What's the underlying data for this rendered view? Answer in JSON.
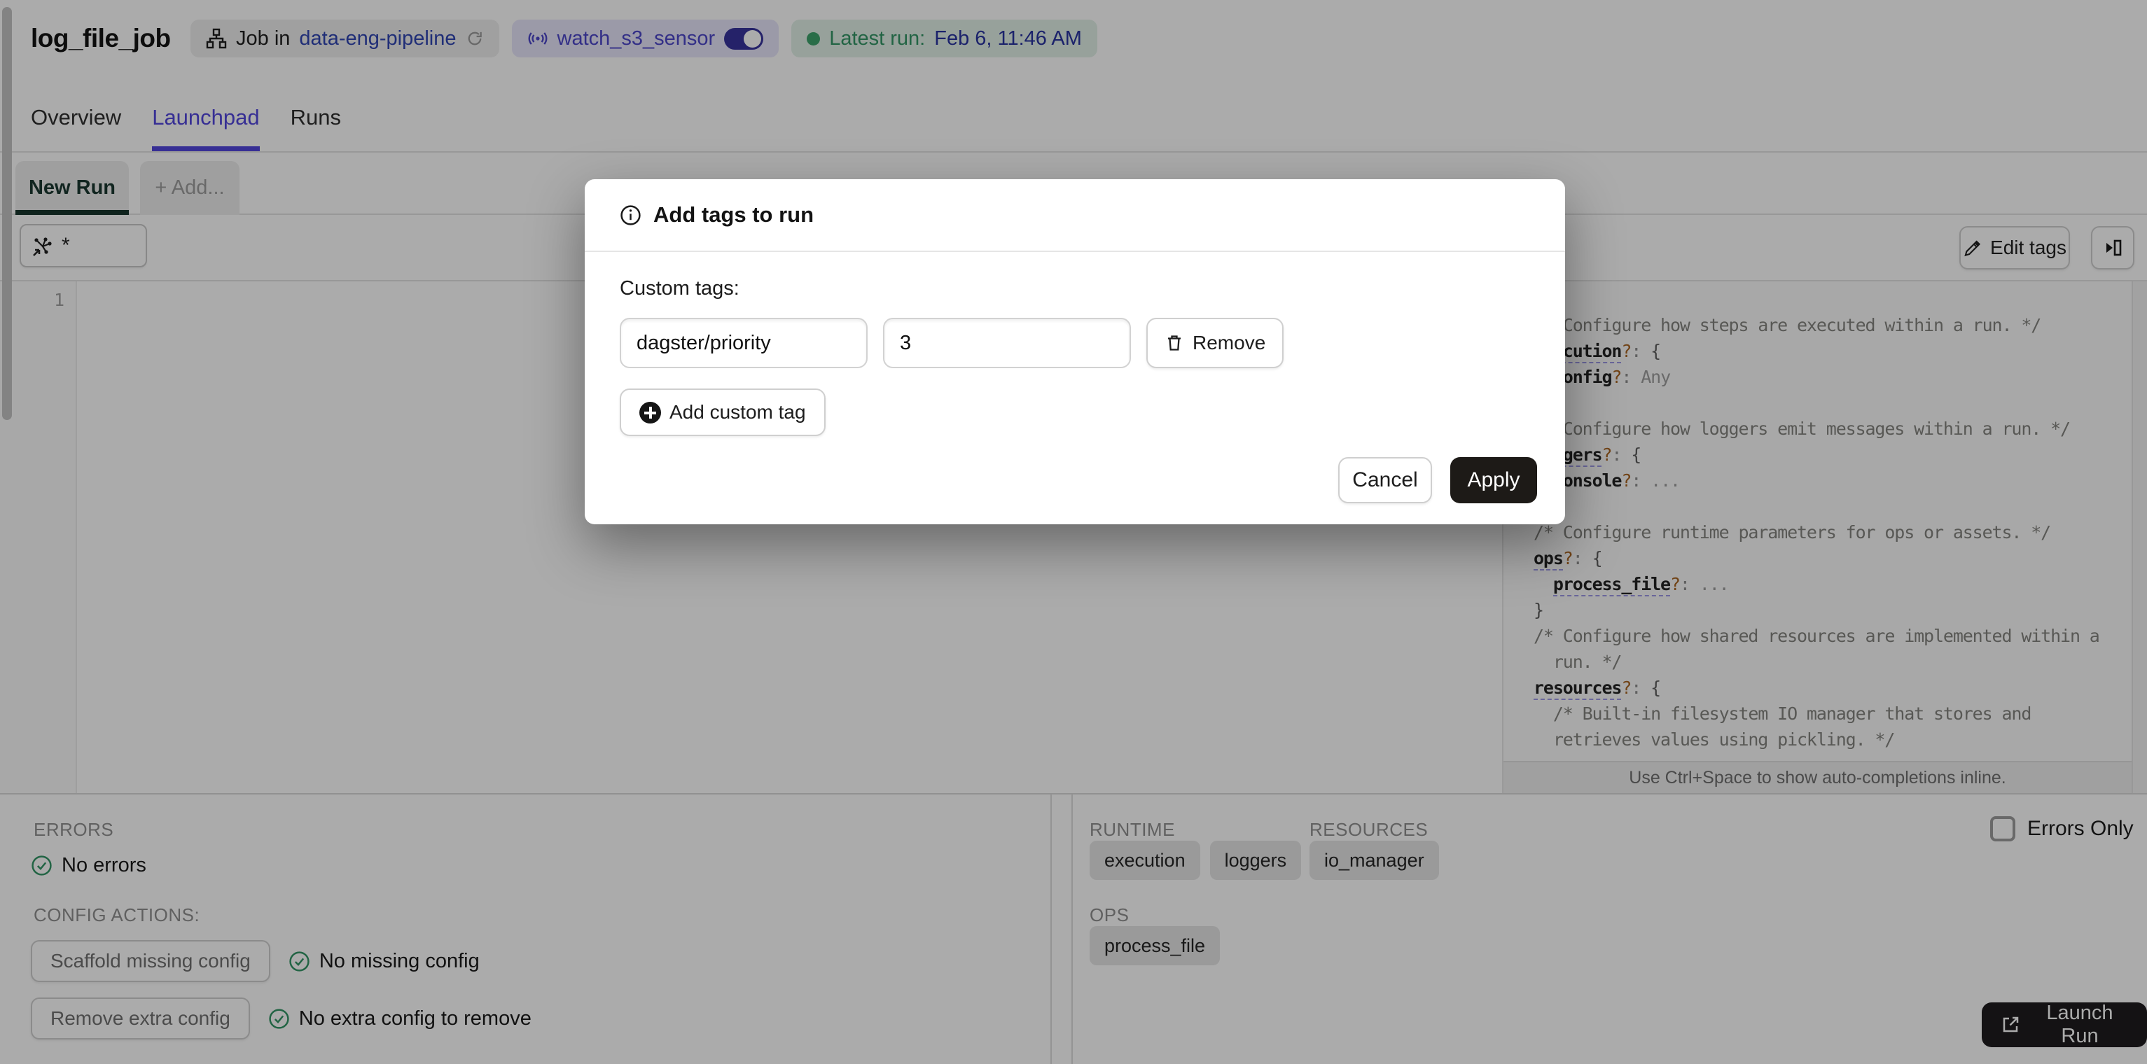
{
  "header": {
    "title": "log_file_job",
    "job_badge": {
      "prefix": "Job in",
      "link": "data-eng-pipeline"
    },
    "sensor_badge": {
      "label": "watch_s3_sensor"
    },
    "latest_run": {
      "label": "Latest run:",
      "value": "Feb 6, 11:46 AM"
    }
  },
  "tabs": {
    "overview": "Overview",
    "launchpad": "Launchpad",
    "runs": "Runs"
  },
  "run_tabs": {
    "new_run": "New Run",
    "add": "+ Add..."
  },
  "toolbar": {
    "op_selector_value": "*",
    "edit_tags": "Edit tags"
  },
  "editor": {
    "line_number": "1"
  },
  "schema_panel": {
    "footer": "Use Ctrl+Space to show auto-completions inline.",
    "lines": [
      [
        [
          "c",
          "/* Configure how steps are executed within a run. */"
        ]
      ],
      [
        [
          "u",
          "execution"
        ],
        [
          "q",
          "?"
        ],
        [
          "p",
          ": "
        ],
        [
          "b",
          "{"
        ]
      ],
      [
        [
          "t",
          "  "
        ],
        [
          "k",
          "config"
        ],
        [
          "q",
          "?"
        ],
        [
          "p",
          ":"
        ],
        [
          "v",
          " Any"
        ]
      ],
      [
        [
          "b",
          "}"
        ]
      ],
      [
        [
          "c",
          "/* Configure how loggers emit messages within a run. */"
        ]
      ],
      [
        [
          "u",
          "loggers"
        ],
        [
          "q",
          "?"
        ],
        [
          "p",
          ": "
        ],
        [
          "b",
          "{"
        ]
      ],
      [
        [
          "t",
          "  "
        ],
        [
          "k",
          "console"
        ],
        [
          "q",
          "?"
        ],
        [
          "p",
          ":"
        ],
        [
          "v",
          " ..."
        ]
      ],
      [
        [
          "b",
          "}"
        ]
      ],
      [
        [
          "c",
          "/* Configure runtime parameters for ops or assets. */"
        ]
      ],
      [
        [
          "u",
          "ops"
        ],
        [
          "q",
          "?"
        ],
        [
          "p",
          ": "
        ],
        [
          "b",
          "{"
        ]
      ],
      [
        [
          "t",
          "  "
        ],
        [
          "u",
          "process_file"
        ],
        [
          "q",
          "?"
        ],
        [
          "p",
          ":"
        ],
        [
          "v",
          " ..."
        ]
      ],
      [
        [
          "b",
          "}"
        ]
      ],
      [
        [
          "c",
          "/* Configure how shared resources are implemented within a"
        ]
      ],
      [
        [
          "c",
          "  run. */"
        ]
      ],
      [
        [
          "u",
          "resources"
        ],
        [
          "q",
          "?"
        ],
        [
          "p",
          ": "
        ],
        [
          "b",
          "{"
        ]
      ],
      [
        [
          "c",
          "  /* Built-in filesystem IO manager that stores and"
        ]
      ],
      [
        [
          "c",
          "  retrieves values using pickling. */"
        ]
      ]
    ]
  },
  "modal": {
    "title": "Add tags to run",
    "custom_tags_label": "Custom tags:",
    "tag_key": "dagster/priority",
    "tag_value": "3",
    "remove": "Remove",
    "add_custom_tag": "Add custom tag",
    "cancel": "Cancel",
    "apply": "Apply"
  },
  "bottom_left": {
    "errors_label": "ERRORS",
    "no_errors": "No errors",
    "config_actions_label": "CONFIG ACTIONS:",
    "scaffold_button": "Scaffold missing config",
    "no_missing": "No missing config",
    "remove_button": "Remove extra config",
    "no_extra": "No extra config to remove"
  },
  "bottom_right": {
    "runtime_label": "RUNTIME",
    "resources_label": "RESOURCES",
    "ops_label": "OPS",
    "runtime_tags": [
      "execution",
      "loggers"
    ],
    "resource_tags": [
      "io_manager"
    ],
    "ops_tags": [
      "process_file"
    ],
    "errors_only": "Errors Only",
    "launch_run": "Launch Run"
  },
  "colors": {
    "accent_blurple": "#4F43DD",
    "link_blue": "#2C42B0",
    "success_green": "#2F9463",
    "primary_button": "#1A181B",
    "new_run_green": "#14332A"
  }
}
